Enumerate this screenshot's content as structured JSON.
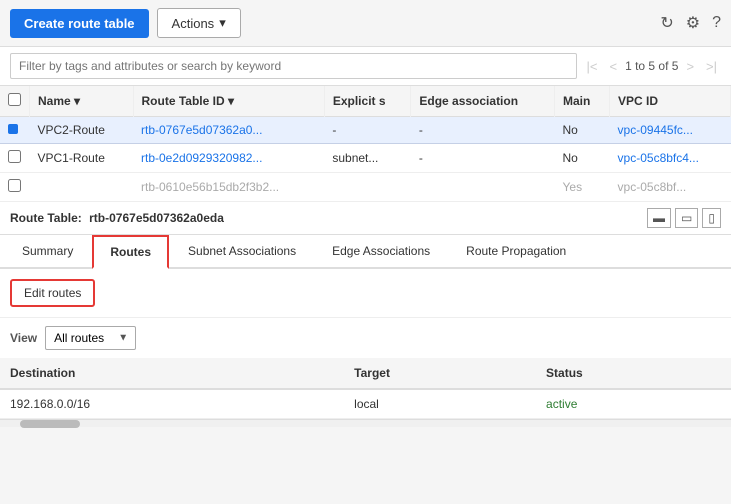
{
  "toolbar": {
    "create_label": "Create route table",
    "actions_label": "Actions",
    "refresh_icon": "↻",
    "settings_icon": "⚙",
    "help_icon": "?"
  },
  "search": {
    "placeholder": "Filter by tags and attributes or search by keyword"
  },
  "pagination": {
    "first": "|<",
    "prev": "<",
    "text": "1 to 5 of 5",
    "next": ">",
    "last": ">|"
  },
  "table": {
    "columns": [
      "",
      "Name",
      "Route Table ID",
      "Explicit s",
      "Edge association",
      "Main",
      "VPC ID"
    ],
    "rows": [
      {
        "selected": true,
        "name": "VPC2-Route",
        "id": "rtb-0767e5d07362a0...",
        "explicit": "-",
        "edge": "-",
        "main": "No",
        "vpc": "vpc-09445fc..."
      },
      {
        "selected": false,
        "name": "VPC1-Route",
        "id": "rtb-0e2d0929320982...",
        "explicit": "subnet...",
        "edge": "-",
        "main": "No",
        "vpc": "vpc-05c8bfc4..."
      },
      {
        "selected": false,
        "name": "",
        "id": "rtb-0610e56b15db2f3b2...",
        "explicit": "",
        "edge": "",
        "main": "Yes",
        "vpc": "vpc-05c8bf..."
      }
    ]
  },
  "route_table_label": {
    "prefix": "Route Table:",
    "id": "rtb-0767e5d07362a0eda"
  },
  "tabs": [
    {
      "label": "Summary",
      "id": "summary",
      "active": false
    },
    {
      "label": "Routes",
      "id": "routes",
      "active": true
    },
    {
      "label": "Subnet Associations",
      "id": "subnet",
      "active": false
    },
    {
      "label": "Edge Associations",
      "id": "edge",
      "active": false
    },
    {
      "label": "Route Propagation",
      "id": "propagation",
      "active": false
    }
  ],
  "edit_routes_label": "Edit routes",
  "view": {
    "label": "View",
    "option": "All routes"
  },
  "routes_table": {
    "columns": [
      "Destination",
      "Target",
      "Status"
    ],
    "rows": [
      {
        "destination": "192.168.0.0/16",
        "target": "local",
        "status": "active"
      }
    ]
  }
}
